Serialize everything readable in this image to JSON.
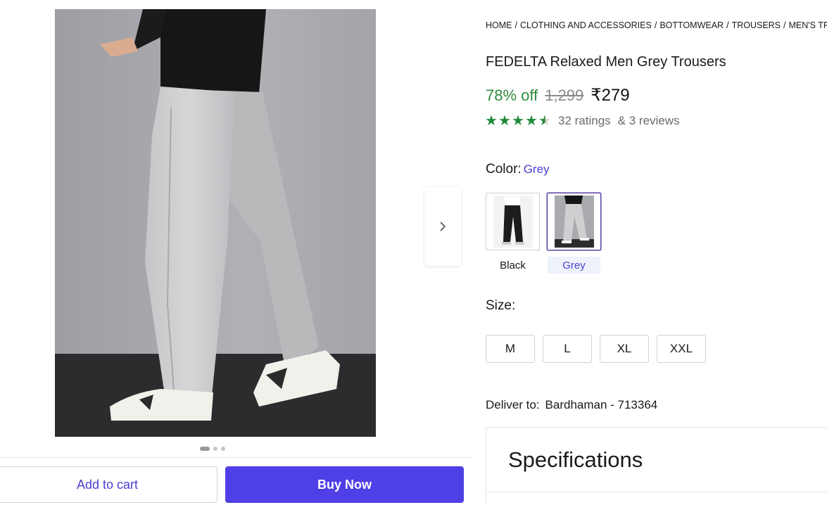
{
  "breadcrumb": [
    "HOME",
    "CLOTHING AND ACCESSORIES",
    "BOTTOMWEAR",
    "TROUSERS",
    "MEN'S TROUSERS"
  ],
  "product": {
    "title": "FEDELTA Relaxed Men Grey Trousers",
    "discount": "78% off",
    "mrp": "1,299",
    "price": "₹279"
  },
  "rating": {
    "stars": 4.5,
    "ratings_text": "32 ratings",
    "reviews_text": "& 3 reviews",
    "star_color": "#1f8a3a"
  },
  "color": {
    "label": "Color:",
    "selected": "Grey",
    "options": [
      {
        "label": "Black",
        "selected": false
      },
      {
        "label": "Grey",
        "selected": true
      }
    ]
  },
  "size": {
    "label": "Size:",
    "options": [
      "M",
      "L",
      "XL",
      "XXL"
    ]
  },
  "delivery": {
    "label": "Deliver to:",
    "location": "Bardhaman - 713364"
  },
  "specifications": {
    "title": "Specifications"
  },
  "carousel": {
    "total_slides": 3,
    "active_slide": 1,
    "next_icon": "chevron-right-icon"
  },
  "actions": {
    "add_to_cart": "Add to cart",
    "buy_now": "Buy Now"
  },
  "colors": {
    "accent": "#4f3fe6",
    "discount_green": "#2e8b3a",
    "link_purple": "#4a3fcf"
  }
}
